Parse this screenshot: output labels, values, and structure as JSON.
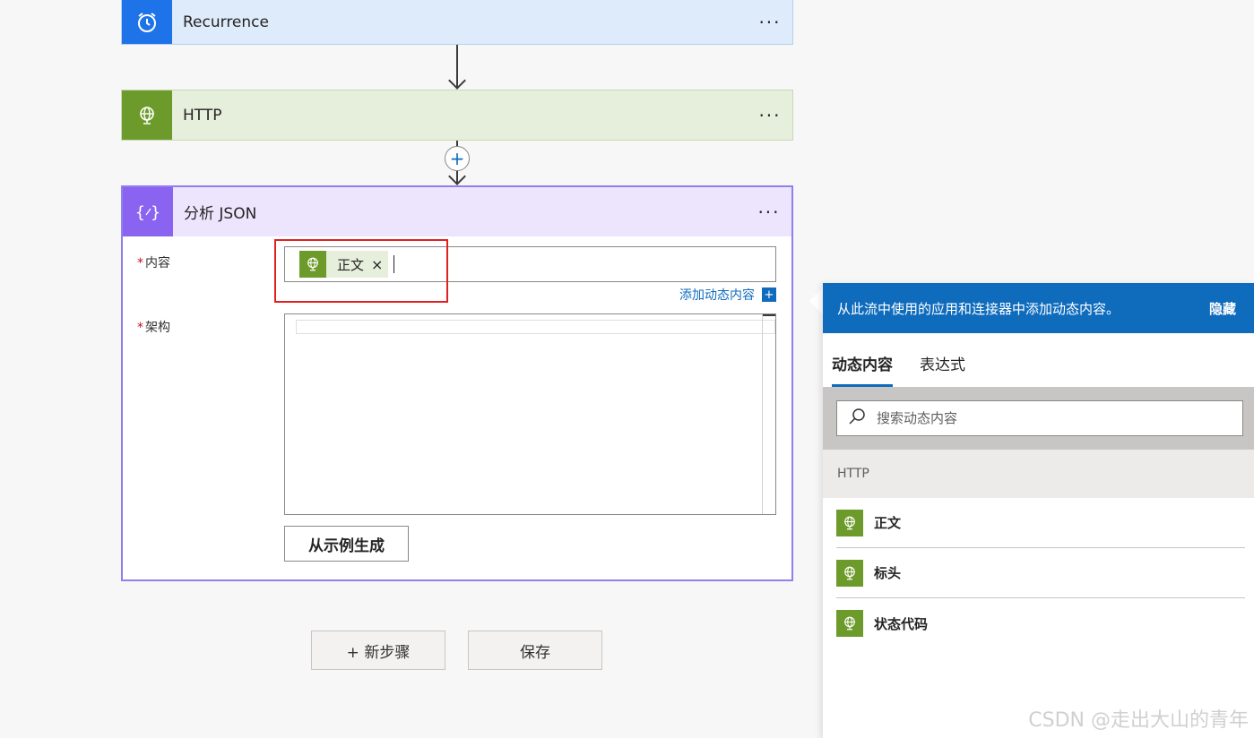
{
  "flow": {
    "recurrence": {
      "title": "Recurrence",
      "more": "···",
      "icon": "alarm-clock-icon"
    },
    "http": {
      "title": "HTTP",
      "more": "···",
      "icon": "globe-icon"
    },
    "connector_plus": "+",
    "parse_json": {
      "title": "分析 JSON",
      "more": "···",
      "icon": "braces-icon",
      "content_label": "内容",
      "schema_label": "架构",
      "required_mark": "*",
      "token_label": "正文",
      "token_close": "×",
      "add_dynamic_label": "添加动态内容",
      "add_dynamic_plus": "+",
      "generate_button": "从示例生成"
    },
    "new_step_button": "+ 新步骤",
    "save_button": "保存"
  },
  "panel": {
    "header_text": "从此流中使用的应用和连接器中添加动态内容。",
    "hide_label": "隐藏",
    "tabs": [
      {
        "label": "动态内容",
        "active": true
      },
      {
        "label": "表达式",
        "active": false
      }
    ],
    "search_placeholder": "搜索动态内容",
    "section": "HTTP",
    "items": [
      {
        "label": "正文",
        "icon": "globe-icon"
      },
      {
        "label": "标头",
        "icon": "globe-icon"
      },
      {
        "label": "状态代码",
        "icon": "globe-icon"
      }
    ]
  },
  "watermark": "CSDN @走出大山的青年",
  "colors": {
    "accent_blue": "#0f6cbd",
    "http_green": "#6d9b2b",
    "parse_purple": "#8a63f0",
    "recurrence_blue": "#1e73e8",
    "highlight_red": "#e02020"
  }
}
